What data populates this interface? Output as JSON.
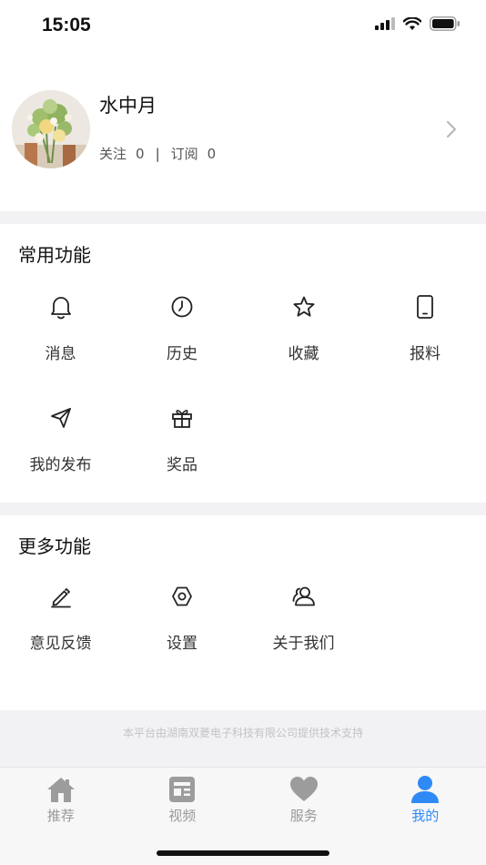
{
  "status_bar": {
    "time": "15:05"
  },
  "profile": {
    "username": "水中月",
    "follow_label": "关注",
    "follow_count": "0",
    "separator": "|",
    "subscribe_label": "订阅",
    "subscribe_count": "0"
  },
  "common": {
    "title": "常用功能",
    "items": [
      {
        "label": "消息",
        "icon": "bell-icon"
      },
      {
        "label": "历史",
        "icon": "clock-icon"
      },
      {
        "label": "收藏",
        "icon": "star-icon"
      },
      {
        "label": "报料",
        "icon": "phone-icon"
      },
      {
        "label": "我的发布",
        "icon": "send-icon"
      },
      {
        "label": "奖品",
        "icon": "gift-icon"
      }
    ]
  },
  "more": {
    "title": "更多功能",
    "items": [
      {
        "label": "意见反馈",
        "icon": "pencil-icon"
      },
      {
        "label": "设置",
        "icon": "settings-icon"
      },
      {
        "label": "关于我们",
        "icon": "users-icon"
      }
    ]
  },
  "footer_note": "本平台由湖南双菱电子科技有限公司提供技术支持",
  "tabbar": {
    "active_color": "#2f8af5",
    "inactive_color": "#999999",
    "tabs": [
      {
        "label": "推荐",
        "icon": "home-icon",
        "active": false
      },
      {
        "label": "视频",
        "icon": "video-icon",
        "active": false
      },
      {
        "label": "服务",
        "icon": "heart-icon",
        "active": false
      },
      {
        "label": "我的",
        "icon": "person-icon",
        "active": true
      }
    ]
  }
}
